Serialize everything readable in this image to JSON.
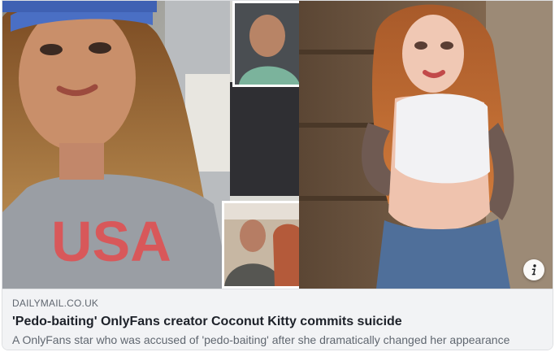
{
  "link_preview": {
    "domain": "DAILYMAIL.CO.UK",
    "headline": "'Pedo-baiting' OnlyFans creator Coconut Kitty commits suicide",
    "description": "A OnlyFans star who was accused of 'pedo-baiting' after she dramatically changed her appearance",
    "info_icon": "info-icon",
    "shirt_text": "USA"
  },
  "colors": {
    "caption_bg": "#f2f3f5",
    "headline": "#1d2129",
    "secondary_text": "#606770",
    "border": "#dddfe2",
    "cap_blue": "#4a6fc4",
    "shirt_grey": "#9a9ea4",
    "shirt_print": "#d8585a"
  }
}
